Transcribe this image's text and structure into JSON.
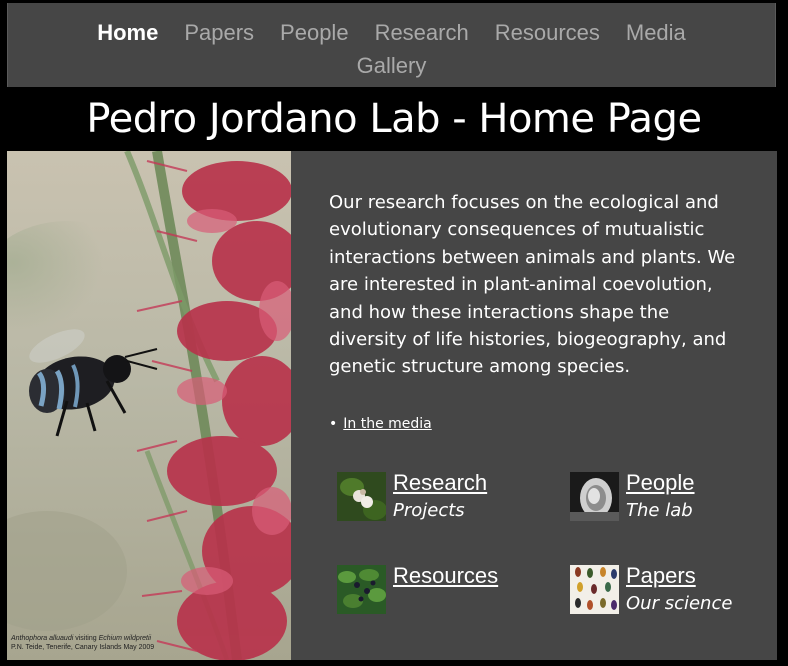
{
  "nav": {
    "items": [
      {
        "label": "Home"
      },
      {
        "label": "Papers"
      },
      {
        "label": "People"
      },
      {
        "label": "Research"
      },
      {
        "label": "Resources"
      },
      {
        "label": "Media"
      },
      {
        "label": "Gallery"
      }
    ],
    "active": "Home"
  },
  "title": "Pedro Jordano Lab - Home Page",
  "photo": {
    "caption_line1_italic": "Anthophora alluaudi",
    "caption_line1_mid": " visiting ",
    "caption_line1_italic2": "Echium wildpretii",
    "caption_line2": "P.N. Teide, Tenerife, Canary Islands May 2009"
  },
  "intro": "Our research focuses on the ecological and evolutionary consequences of mutualistic interactions between animals and plants. We are  interested in plant-animal coevolution, and how these interactions shape the diversity of life histories, biogeography, and genetic structure among species.",
  "media_link": "In the media",
  "cards": {
    "research": {
      "label": "Research",
      "sub": "Projects"
    },
    "people": {
      "label": "People",
      "sub": "The lab"
    },
    "resources": {
      "label": "Resources",
      "sub": ""
    },
    "papers": {
      "label": "Papers",
      "sub": "Our science"
    }
  },
  "colors": {
    "page_bg": "#000000",
    "panel_bg": "#464646",
    "nav_inactive": "#a9a9a9",
    "nav_active": "#ffffff"
  }
}
